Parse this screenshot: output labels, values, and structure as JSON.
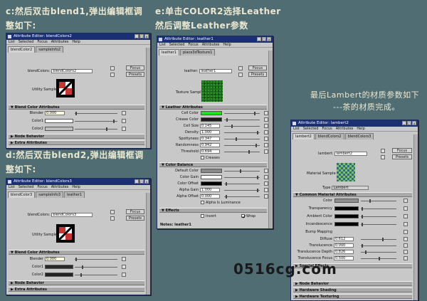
{
  "captions": {
    "c": "c:然后双击blend1,弹出编辑框调",
    "c2": "整如下:",
    "d": "d:然后双击blend2,弹出编辑框调",
    "d2": "整如下:",
    "e": "e:单击COLOR2选择Leather",
    "e2": "然后调整Leather参数",
    "f": "最后Lambert的材质参数如下",
    "f2": "---茶的材质完成。"
  },
  "menu": [
    "List",
    "Selected",
    "Focus",
    "Attributes",
    "Help"
  ],
  "win1": {
    "title": "Attribute Editor: blendColors2",
    "tabs": [
      "blendColor2",
      "sampleInfo2"
    ],
    "node_label": "blendColors:",
    "node_value": "blendColors2",
    "focus": "Focus",
    "presets": "Presets",
    "utility": "Utility Sample",
    "section": "Blend Color Attributes",
    "blender_lbl": "Blender",
    "blender_val": "0.000",
    "color1": "Color1",
    "color2": "Color2",
    "node_behavior": "Node Behavior",
    "extra": "Extra Attributes"
  },
  "win2": {
    "title": "Attribute Editor: blendColors3",
    "tabs": [
      "blendColor3",
      "sampleInfo3",
      "leather1"
    ],
    "node_label": "blendColors:",
    "node_value": "blendColors3",
    "focus": "Focus",
    "presets": "Presets",
    "utility": "Utility Sample",
    "section": "Blend Color Attributes",
    "blender_lbl": "Blender",
    "blender_val": "0.000",
    "color1": "Color1",
    "color2": "Color2",
    "node_behavior": "Node Behavior",
    "extra": "Extra Attributes"
  },
  "win3": {
    "title": "Attribute Editor: leather1",
    "tabs": [
      "leather1",
      "place3dTexture1"
    ],
    "node_label": "leather:",
    "node_value": "leather1",
    "focus": "Focus",
    "presets": "Presets",
    "sample": "Texture Sample",
    "section1": "Leather Attributes",
    "attrs": [
      {
        "l": "Cell Color",
        "v": ""
      },
      {
        "l": "Crease Color",
        "v": ""
      },
      {
        "l": "Cell Size",
        "v": "0.145"
      },
      {
        "l": "Density",
        "v": "1.000"
      },
      {
        "l": "Spottyness",
        "v": "0.347"
      },
      {
        "l": "Randomness",
        "v": "0.942"
      },
      {
        "l": "Threshold",
        "v": "0.694"
      }
    ],
    "creases": "Creases",
    "section2": "Color Balance",
    "attrs2": [
      {
        "l": "Default Color",
        "v": ""
      },
      {
        "l": "Color Gain",
        "v": ""
      },
      {
        "l": "Color Offset",
        "v": ""
      },
      {
        "l": "Alpha Gain",
        "v": "1.000"
      },
      {
        "l": "Alpha Offset",
        "v": "0.000"
      }
    ],
    "alpha_lum": "Alpha Is Luminance",
    "section3": "Effects",
    "invert": "Invert",
    "wrap": "Wrap",
    "notes": "Notes: leather1"
  },
  "win4": {
    "title": "Attribute Editor: lambert2",
    "tabs": [
      "lambert2",
      "blendColors2",
      "blendColors3"
    ],
    "node_label": "lambert:",
    "node_value": "lambert2",
    "focus": "Focus",
    "presets": "Presets",
    "sample": "Material Sample",
    "type_lbl": "Type",
    "type_val": "Lambert",
    "section": "Common Material Attributes",
    "attrs": [
      {
        "l": "Color",
        "v": ""
      },
      {
        "l": "Transparency",
        "v": ""
      },
      {
        "l": "Ambient Color",
        "v": ""
      },
      {
        "l": "Incandescence",
        "v": ""
      },
      {
        "l": "Bump Mapping",
        "v": ""
      },
      {
        "l": "Diffuse",
        "v": "0.612"
      },
      {
        "l": "Translucence",
        "v": "0.000"
      },
      {
        "l": "Translucence Depth",
        "v": "0.826"
      },
      {
        "l": "Translucence Focus",
        "v": "0.500"
      }
    ],
    "special": "Special Effects",
    "nb": "Node Behavior",
    "hs": "Hardware Shading",
    "ht": "Hardware Texturing"
  },
  "watermark": "0516cg.com"
}
